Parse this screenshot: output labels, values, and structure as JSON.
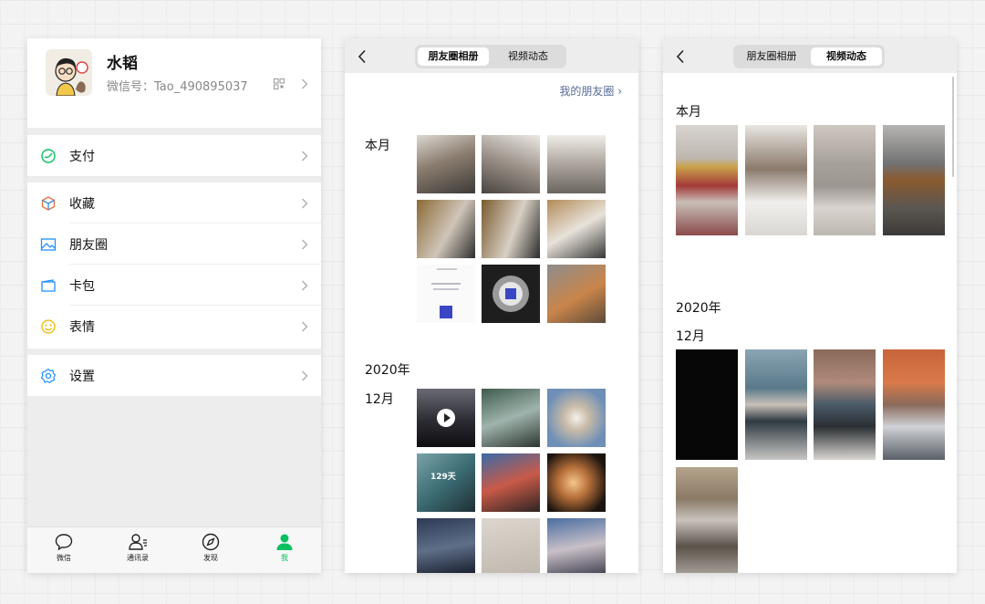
{
  "me_screen": {
    "profile": {
      "nickname": "水韬",
      "wechat_id": "微信号：Tao_490895037"
    },
    "menu": [
      {
        "label": "支付",
        "icon": "pay-icon",
        "color": "#07c160"
      },
      {
        "label": "收藏",
        "icon": "favorites-icon",
        "color": "#ea6e3a"
      },
      {
        "label": "朋友圈",
        "icon": "moments-icon",
        "color": "#1e90ff"
      },
      {
        "label": "卡包",
        "icon": "card-icon",
        "color": "#1e90ff"
      },
      {
        "label": "表情",
        "icon": "sticker-icon",
        "color": "#f2b400"
      },
      {
        "label": "设置",
        "icon": "settings-icon",
        "color": "#1e90ff"
      }
    ],
    "tabbar": [
      {
        "label": "微信",
        "icon": "chat-bubble-icon",
        "active": false
      },
      {
        "label": "通讯录",
        "icon": "contacts-icon",
        "active": false
      },
      {
        "label": "发现",
        "icon": "compass-icon",
        "active": false
      },
      {
        "label": "我",
        "icon": "person-icon",
        "active": true
      }
    ],
    "accent_color": "#07c160"
  },
  "moments_album_screen": {
    "tabs": [
      "朋友圈相册",
      "视频动态"
    ],
    "active_tab": 0,
    "link": "我的朋友圈",
    "sections": [
      {
        "label": "本月",
        "year": ""
      },
      {
        "label": "12月",
        "year": "2020年"
      }
    ],
    "thumb_text": "129天",
    "link_color": "#576b95"
  },
  "video_status_screen": {
    "tabs": [
      "朋友圈相册",
      "视频动态"
    ],
    "active_tab": 1,
    "sections": [
      {
        "label": "本月"
      },
      {
        "year": "2020年",
        "label": "12月"
      }
    ]
  }
}
